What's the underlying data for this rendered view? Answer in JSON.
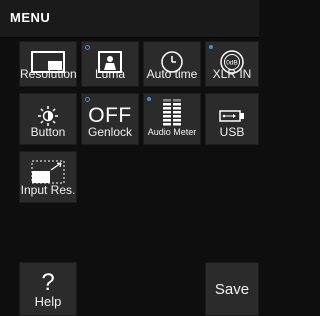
{
  "header": {
    "title": "MENU"
  },
  "tiles": {
    "resolution": {
      "label": "Resolution",
      "icon": "display-icon"
    },
    "luma": {
      "label": "Luma",
      "icon": "person-frame-icon",
      "indicator": "hollow"
    },
    "auto_time": {
      "label": "Auto time",
      "icon": "clock-icon"
    },
    "xlr_in": {
      "label": "XLR IN",
      "icon": "xlr-connector-icon",
      "indicator": "filled",
      "icon_text": "0dB"
    },
    "button": {
      "label": "Button",
      "icon": "brightness-icon"
    },
    "genlock": {
      "label": "Genlock",
      "value": "OFF",
      "indicator": "hollow"
    },
    "audio_meter": {
      "label": "Audio Meter",
      "icon": "audio-meter-icon",
      "indicator": "filled"
    },
    "usb": {
      "label": "USB",
      "icon": "usb-icon"
    },
    "input_res": {
      "label": "Input Res.",
      "icon": "input-resolution-icon"
    },
    "help": {
      "label": "Help",
      "icon": "help-icon",
      "icon_text": "?"
    },
    "save": {
      "label": "Save"
    }
  },
  "colors": {
    "indicator": "#3a8fe0",
    "tile": "#2b2b2b",
    "background": "#0e0e0e"
  }
}
